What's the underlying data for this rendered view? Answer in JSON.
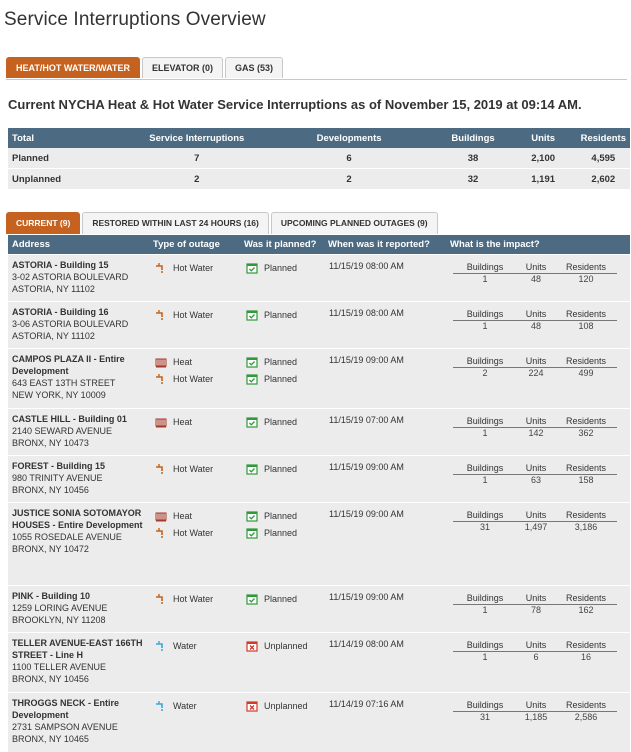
{
  "page": {
    "title": "Service Interruptions Overview"
  },
  "main_tabs": [
    {
      "label": "HEAT/HOT WATER/WATER",
      "active": true
    },
    {
      "label": "ELEVATOR (0)",
      "active": false
    },
    {
      "label": "GAS (53)",
      "active": false
    }
  ],
  "heading": "Current NYCHA Heat & Hot Water Service Interruptions as of November 15, 2019 at 09:14 AM.",
  "summary": {
    "headers": [
      "Total",
      "Service Interruptions",
      "Developments",
      "Buildings",
      "Units",
      "Residents"
    ],
    "rows": [
      [
        "Planned",
        "7",
        "6",
        "38",
        "2,100",
        "4,595"
      ],
      [
        "Unplanned",
        "2",
        "2",
        "32",
        "1,191",
        "2,602"
      ]
    ]
  },
  "sub_tabs": [
    {
      "label": "CURRENT (9)",
      "active": true
    },
    {
      "label": "RESTORED WITHIN LAST 24 HOURS (16)",
      "active": false
    },
    {
      "label": "UPCOMING PLANNED OUTAGES (9)",
      "active": false
    }
  ],
  "detail_headers": {
    "address": "Address",
    "type": "Type of outage",
    "planned": "Was it planned?",
    "reported": "When was it reported?",
    "impact": "What is the impact?"
  },
  "impact_labels": {
    "buildings": "Buildings",
    "units": "Units",
    "residents": "Residents"
  },
  "colors": {
    "accent": "#c5621f",
    "header": "#4c6b83",
    "row_bg": "#ececec",
    "planned_icon": "#2e9a3a",
    "unplanned_icon": "#d23a2a",
    "water_icon": "#3aa7d8",
    "heat_icon": "#a83a2a"
  },
  "interruptions": [
    {
      "name": "ASTORIA - Building 15",
      "address_lines": [
        "3-02 ASTORIA BOULEVARD",
        "ASTORIA, NY 11102"
      ],
      "outages": [
        {
          "type": "Hot Water",
          "icon": "hot-water-icon",
          "planned": "Planned"
        }
      ],
      "reported": "11/15/19 08:00 AM",
      "buildings": "1",
      "units": "48",
      "residents": "120"
    },
    {
      "name": "ASTORIA - Building 16",
      "address_lines": [
        "3-06 ASTORIA BOULEVARD",
        "ASTORIA, NY 11102"
      ],
      "outages": [
        {
          "type": "Hot Water",
          "icon": "hot-water-icon",
          "planned": "Planned"
        }
      ],
      "reported": "11/15/19 08:00 AM",
      "buildings": "1",
      "units": "48",
      "residents": "108"
    },
    {
      "name": "CAMPOS PLAZA II - Entire Development",
      "address_lines": [
        "643 EAST 13TH STREET",
        "NEW YORK, NY 10009"
      ],
      "outages": [
        {
          "type": "Heat",
          "icon": "heat-icon",
          "planned": "Planned"
        },
        {
          "type": "Hot Water",
          "icon": "hot-water-icon",
          "planned": "Planned"
        }
      ],
      "reported": "11/15/19 09:00 AM",
      "buildings": "2",
      "units": "224",
      "residents": "499"
    },
    {
      "name": "CASTLE HILL - Building 01",
      "address_lines": [
        "2140 SEWARD AVENUE",
        "BRONX, NY 10473"
      ],
      "outages": [
        {
          "type": "Heat",
          "icon": "heat-icon",
          "planned": "Planned"
        }
      ],
      "reported": "11/15/19 07:00 AM",
      "buildings": "1",
      "units": "142",
      "residents": "362"
    },
    {
      "name": "FOREST - Building 15",
      "address_lines": [
        "980 TRINITY AVENUE",
        "BRONX, NY 10456"
      ],
      "outages": [
        {
          "type": "Hot Water",
          "icon": "hot-water-icon",
          "planned": "Planned"
        }
      ],
      "reported": "11/15/19 09:00 AM",
      "buildings": "1",
      "units": "63",
      "residents": "158"
    },
    {
      "name": "JUSTICE SONIA SOTOMAYOR HOUSES - Entire Development",
      "address_lines": [
        "1055 ROSEDALE AVENUE",
        "BRONX, NY 10472"
      ],
      "outages": [
        {
          "type": "Heat",
          "icon": "heat-icon",
          "planned": "Planned"
        },
        {
          "type": "Hot Water",
          "icon": "hot-water-icon",
          "planned": "Planned"
        }
      ],
      "reported": "11/15/19 09:00 AM",
      "buildings": "31",
      "units": "1,497",
      "residents": "3,186"
    },
    {
      "name": "PINK - Building 10",
      "address_lines": [
        "1259 LORING AVENUE",
        "BROOKLYN, NY 11208"
      ],
      "outages": [
        {
          "type": "Hot Water",
          "icon": "hot-water-icon",
          "planned": "Planned"
        }
      ],
      "reported": "11/15/19 09:00 AM",
      "buildings": "1",
      "units": "78",
      "residents": "162"
    },
    {
      "name": "TELLER AVENUE-EAST 166TH STREET - Line H",
      "address_lines": [
        "1100 TELLER AVENUE",
        "BRONX, NY 10456"
      ],
      "outages": [
        {
          "type": "Water",
          "icon": "water-icon",
          "planned": "Unplanned"
        }
      ],
      "reported": "11/14/19 08:00 AM",
      "buildings": "1",
      "units": "6",
      "residents": "16"
    },
    {
      "name": "THROGGS NECK - Entire Development",
      "address_lines": [
        "2731 SAMPSON AVENUE",
        "BRONX, NY 10465"
      ],
      "outages": [
        {
          "type": "Water",
          "icon": "water-icon",
          "planned": "Unplanned"
        }
      ],
      "reported": "11/14/19 07:16 AM",
      "buildings": "31",
      "units": "1,185",
      "residents": "2,586"
    }
  ]
}
